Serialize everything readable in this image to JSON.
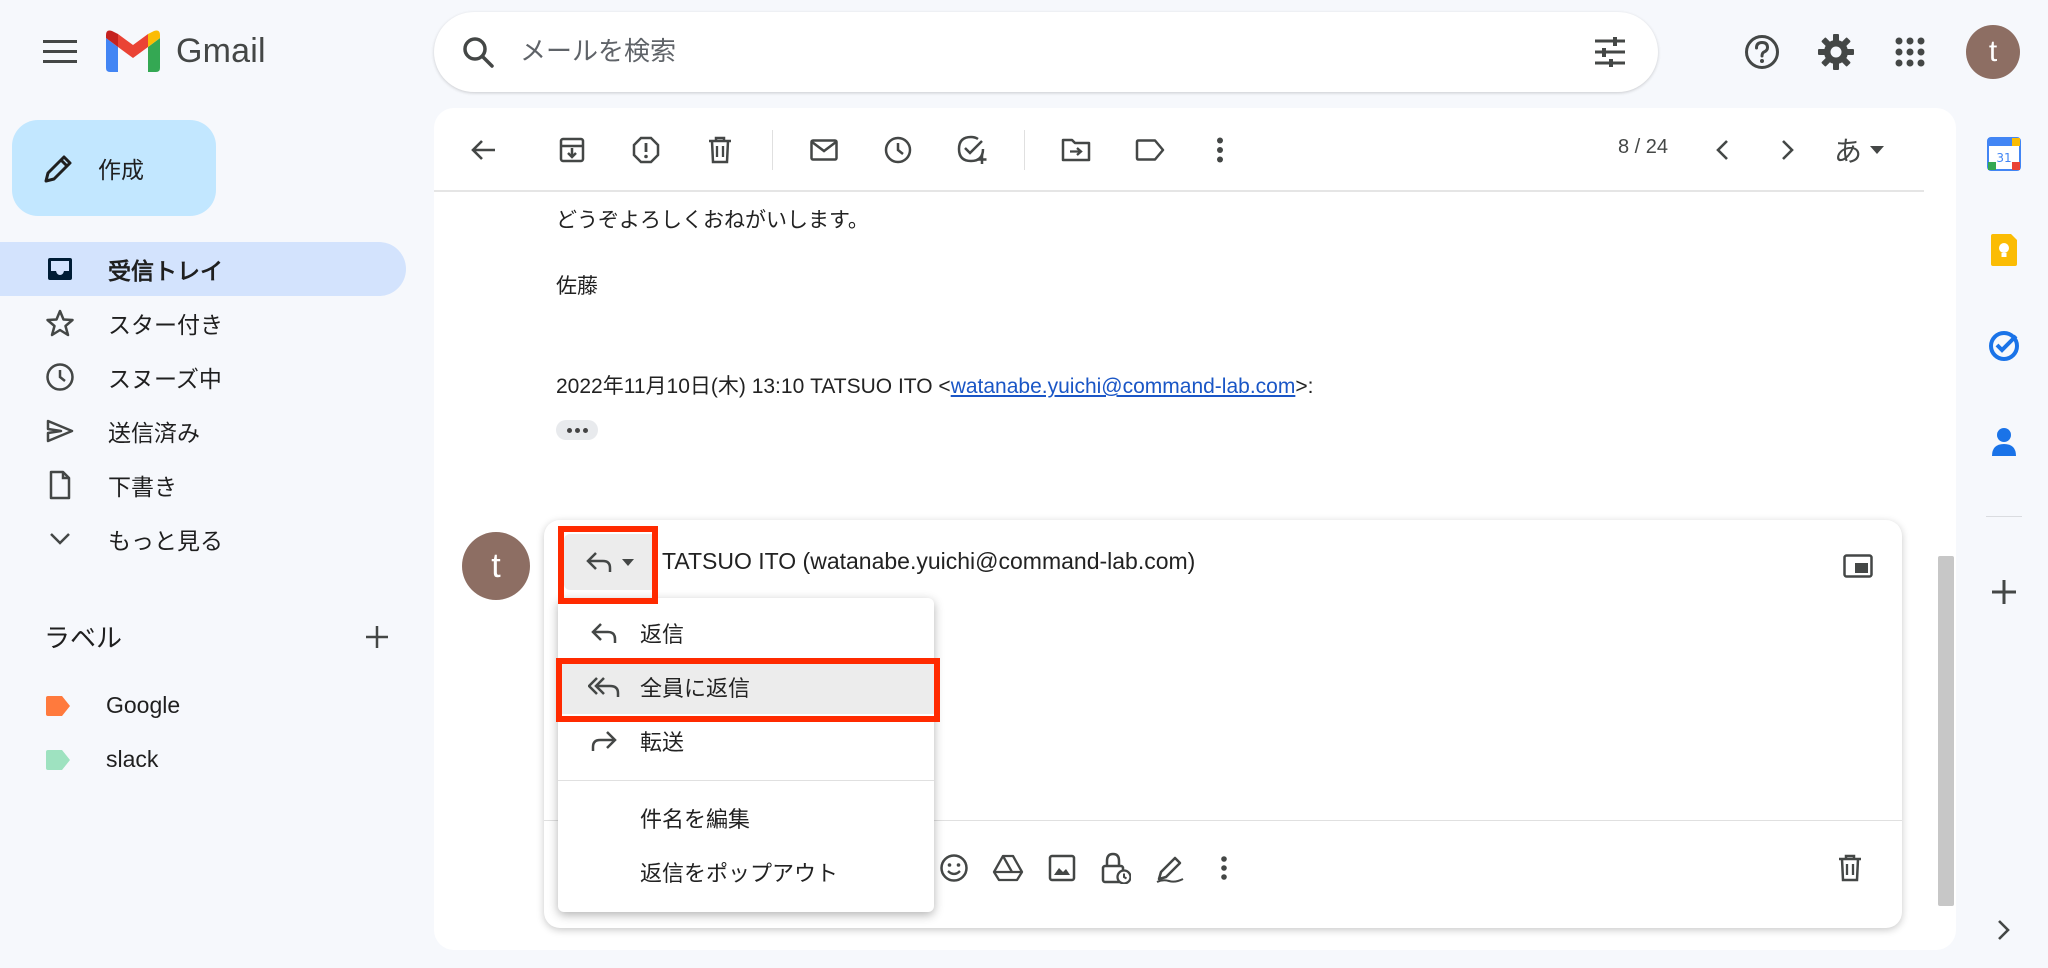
{
  "app": {
    "name": "Gmail",
    "avatar_letter": "t"
  },
  "search": {
    "placeholder": "メールを検索"
  },
  "compose": {
    "label": "作成"
  },
  "nav": {
    "items": [
      {
        "label": "受信トレイ",
        "icon": "inbox-icon",
        "active": true
      },
      {
        "label": "スター付き",
        "icon": "star-icon"
      },
      {
        "label": "スヌーズ中",
        "icon": "clock-icon"
      },
      {
        "label": "送信済み",
        "icon": "send-icon"
      },
      {
        "label": "下書き",
        "icon": "draft-icon"
      },
      {
        "label": "もっと見る",
        "icon": "chevron-down-icon"
      }
    ]
  },
  "labels": {
    "title": "ラベル",
    "items": [
      {
        "label": "Google",
        "color": "#ff7a3d"
      },
      {
        "label": "slack",
        "color": "#9ee2c0"
      }
    ]
  },
  "toolbar": {
    "pager": "8 / 24",
    "lang": "あ"
  },
  "message": {
    "lines": [
      "どうぞよろしくおねがいします。",
      "佐藤"
    ],
    "quote_prefix": "2022年11月10日(木) 13:10 TATSUO ITO <",
    "quote_email": "watanabe.yuichi@command-lab.com",
    "quote_suffix": ">:"
  },
  "reply": {
    "avatar_letter": "t",
    "recipient": "TATSUO ITO (watanabe.yuichi@command-lab.com)"
  },
  "reply_menu": {
    "items": [
      {
        "label": "返信",
        "icon": "reply-icon"
      },
      {
        "label": "全員に返信",
        "icon": "reply-all-icon",
        "highlighted": true
      },
      {
        "label": "転送",
        "icon": "forward-icon"
      }
    ],
    "extra": [
      {
        "label": "件名を編集"
      },
      {
        "label": "返信をポップアウト"
      }
    ]
  },
  "colors": {
    "highlight_border": "#ff2a00",
    "active_nav": "#d3e3fd",
    "compose_bg": "#c2e7ff"
  }
}
